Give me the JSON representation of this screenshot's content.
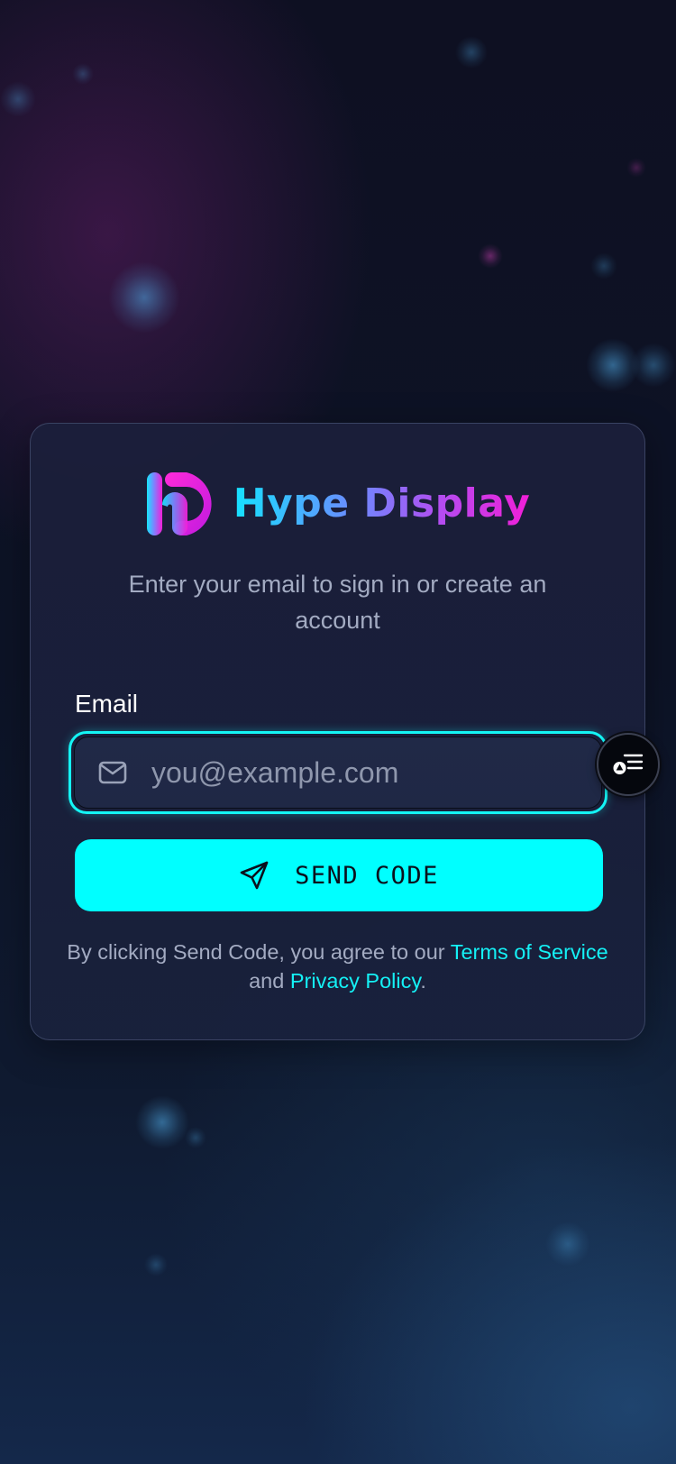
{
  "app": {
    "brand_name": "Hype Display"
  },
  "login": {
    "subtitle": "Enter your email to sign in or create an account",
    "email_label": "Email",
    "email_placeholder": "you@example.com",
    "email_value": "",
    "send_button_label": "SEND CODE",
    "legal": {
      "prefix": "By clicking Send Code, you agree to our ",
      "terms_link": "Terms of Service",
      "middle": " and ",
      "privacy_link": "Privacy Policy",
      "suffix": "."
    }
  },
  "icons": {
    "logo": "hd-logo-icon",
    "email_field": "mail-icon",
    "send_button": "send-icon",
    "floating_button": "menu-list-icon"
  },
  "colors": {
    "accent_cyan": "#00ffff",
    "brand_magenta": "#f21ed8",
    "card_bg": "#1b1f3a",
    "text_muted": "#a3abc2"
  }
}
